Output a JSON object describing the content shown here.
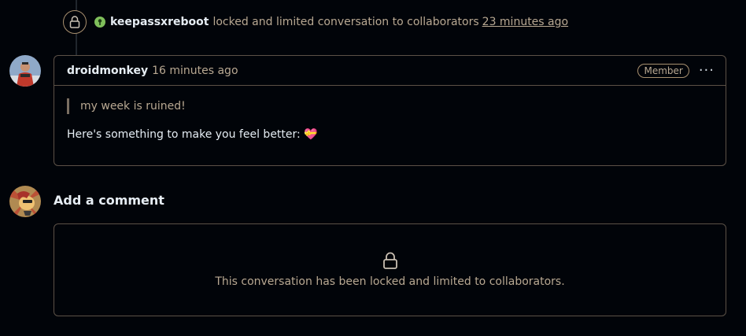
{
  "event": {
    "actor": "keepassxreboot",
    "text": "locked and limited conversation to collaborators",
    "time": "23 minutes ago"
  },
  "comment": {
    "author": "droidmonkey",
    "time": "16 minutes ago",
    "role_badge": "Member",
    "quote": "my week is ruined!",
    "body": "Here's something to make you feel better: 💝"
  },
  "add_comment": {
    "title": "Add a comment",
    "locked_message": "This conversation has been locked and limited to collaborators."
  }
}
